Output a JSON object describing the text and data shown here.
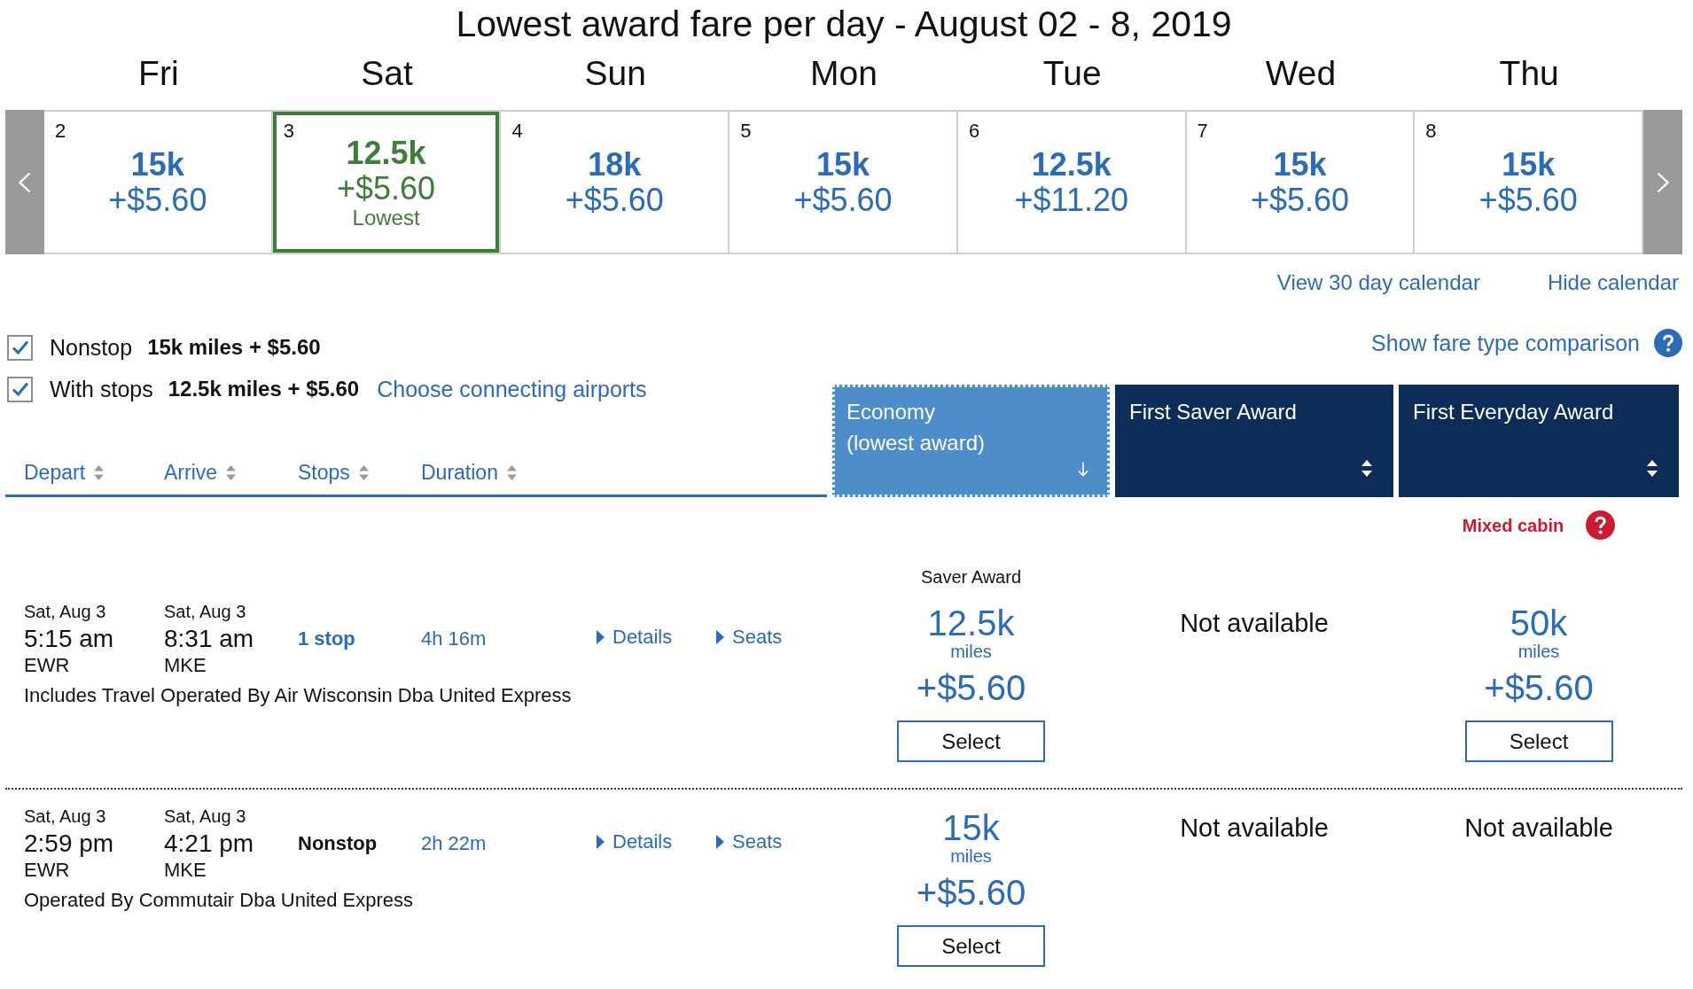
{
  "calendar": {
    "title": "Lowest award fare per day - August 02 - 8, 2019",
    "days": [
      {
        "weekday": "Fri",
        "date": "2",
        "miles": "15k",
        "fee": "+$5.60",
        "selected": false
      },
      {
        "weekday": "Sat",
        "date": "3",
        "miles": "12.5k",
        "fee": "+$5.60",
        "note": "Lowest",
        "selected": true
      },
      {
        "weekday": "Sun",
        "date": "4",
        "miles": "18k",
        "fee": "+$5.60",
        "selected": false
      },
      {
        "weekday": "Mon",
        "date": "5",
        "miles": "15k",
        "fee": "+$5.60",
        "selected": false
      },
      {
        "weekday": "Tue",
        "date": "6",
        "miles": "12.5k",
        "fee": "+$11.20",
        "selected": false
      },
      {
        "weekday": "Wed",
        "date": "7",
        "miles": "15k",
        "fee": "+$5.60",
        "selected": false
      },
      {
        "weekday": "Thu",
        "date": "8",
        "miles": "15k",
        "fee": "+$5.60",
        "selected": false
      }
    ],
    "links": [
      "View 30 day calendar",
      "Hide calendar"
    ]
  },
  "filters": [
    {
      "label": "Nonstop",
      "price": "15k miles + $5.60",
      "checked": true
    },
    {
      "label": "With stops",
      "price": "12.5k miles + $5.60",
      "checked": true,
      "link": "Choose connecting airports"
    }
  ],
  "fare_comparison_link": "Show fare type comparison",
  "sort_columns": [
    "Depart",
    "Arrive",
    "Stops",
    "Duration"
  ],
  "fare_columns": [
    {
      "label": "Economy",
      "sublabel": "(lowest award)",
      "selected": true
    },
    {
      "label": "First Saver Award",
      "selected": false
    },
    {
      "label": "First Everyday Award",
      "selected": false,
      "note": "Mixed cabin"
    }
  ],
  "flights": [
    {
      "depart": {
        "date": "Sat, Aug 3",
        "time": "5:15 am",
        "airport": "EWR"
      },
      "arrive": {
        "date": "Sat, Aug 3",
        "time": "8:31 am",
        "airport": "MKE"
      },
      "stops": {
        "text": "1 stop",
        "link": true
      },
      "duration": "4h 16m",
      "actions": [
        "Details",
        "Seats"
      ],
      "operator": "Includes Travel Operated By Air Wisconsin Dba United Express",
      "fares": [
        {
          "kind": "price",
          "label": "Saver Award",
          "miles": "12.5k",
          "unit": "miles",
          "fee": "+$5.60",
          "button": "Select"
        },
        {
          "kind": "unavailable",
          "text": "Not available"
        },
        {
          "kind": "price",
          "miles": "50k",
          "unit": "miles",
          "fee": "+$5.60",
          "button": "Select"
        }
      ]
    },
    {
      "depart": {
        "date": "Sat, Aug 3",
        "time": "2:59 pm",
        "airport": "EWR"
      },
      "arrive": {
        "date": "Sat, Aug 3",
        "time": "4:21 pm",
        "airport": "MKE"
      },
      "stops": {
        "text": "Nonstop",
        "link": false
      },
      "duration": "2h 22m",
      "actions": [
        "Details",
        "Seats"
      ],
      "operator": "Operated By Commutair Dba United Express",
      "fares": [
        {
          "kind": "price",
          "miles": "15k",
          "unit": "miles",
          "fee": "+$5.60",
          "button": "Select"
        },
        {
          "kind": "unavailable",
          "text": "Not available"
        },
        {
          "kind": "unavailable",
          "text": "Not available"
        }
      ]
    }
  ]
}
